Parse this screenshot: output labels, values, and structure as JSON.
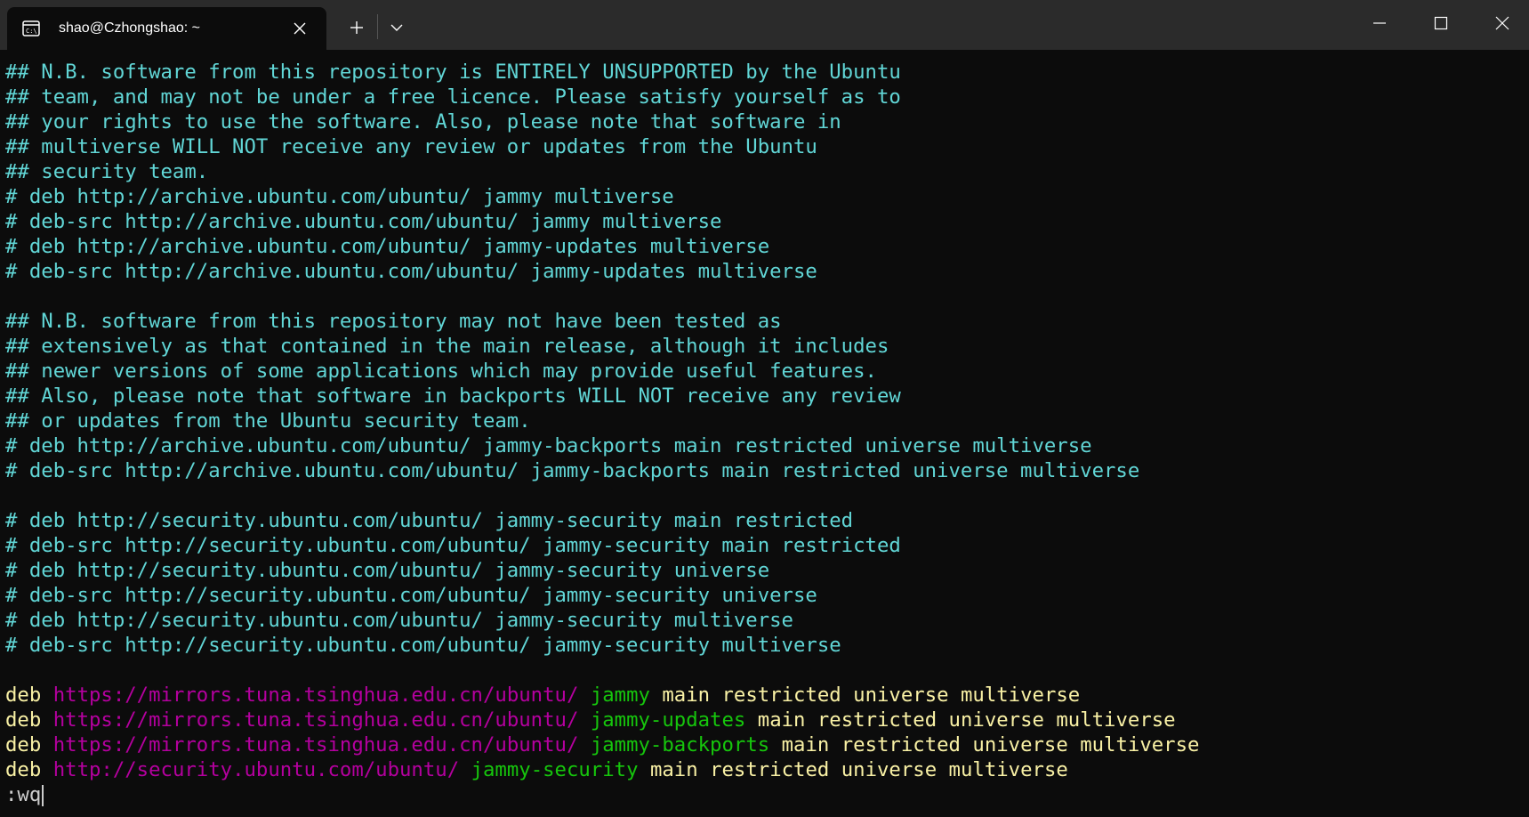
{
  "window": {
    "tab_title": "shao@Czhongshao: ~",
    "tab_icon": "terminal-icon",
    "new_tab_icon": "plus-icon",
    "dropdown_icon": "chevron-down-icon",
    "minimize_icon": "minimize-icon",
    "maximize_icon": "maximize-icon",
    "close_icon": "close-icon"
  },
  "colors": {
    "background": "#0c0c0c",
    "titlebar": "#2b2b2b",
    "comment": "#61d6d6",
    "keyword": "#f9f1a5",
    "url": "#b4009e",
    "distribution": "#16c60c"
  },
  "comment_block_1": [
    "## N.B. software from this repository is ENTIRELY UNSUPPORTED by the Ubuntu",
    "## team, and may not be under a free licence. Please satisfy yourself as to",
    "## your rights to use the software. Also, please note that software in",
    "## multiverse WILL NOT receive any review or updates from the Ubuntu",
    "## security team.",
    "# deb http://archive.ubuntu.com/ubuntu/ jammy multiverse",
    "# deb-src http://archive.ubuntu.com/ubuntu/ jammy multiverse",
    "# deb http://archive.ubuntu.com/ubuntu/ jammy-updates multiverse",
    "# deb-src http://archive.ubuntu.com/ubuntu/ jammy-updates multiverse"
  ],
  "comment_block_2": [
    "## N.B. software from this repository may not have been tested as",
    "## extensively as that contained in the main release, although it includes",
    "## newer versions of some applications which may provide useful features.",
    "## Also, please note that software in backports WILL NOT receive any review",
    "## or updates from the Ubuntu security team.",
    "# deb http://archive.ubuntu.com/ubuntu/ jammy-backports main restricted universe multiverse",
    "# deb-src http://archive.ubuntu.com/ubuntu/ jammy-backports main restricted universe multiverse"
  ],
  "comment_block_3": [
    "# deb http://security.ubuntu.com/ubuntu/ jammy-security main restricted",
    "# deb-src http://security.ubuntu.com/ubuntu/ jammy-security main restricted",
    "# deb http://security.ubuntu.com/ubuntu/ jammy-security universe",
    "# deb-src http://security.ubuntu.com/ubuntu/ jammy-security universe",
    "# deb http://security.ubuntu.com/ubuntu/ jammy-security multiverse",
    "# deb-src http://security.ubuntu.com/ubuntu/ jammy-security multiverse"
  ],
  "sources": [
    {
      "type": "deb",
      "url": "https://mirrors.tuna.tsinghua.edu.cn/ubuntu/",
      "dist": "jammy",
      "components": "main restricted universe multiverse"
    },
    {
      "type": "deb",
      "url": "https://mirrors.tuna.tsinghua.edu.cn/ubuntu/",
      "dist": "jammy-updates",
      "components": "main restricted universe multiverse"
    },
    {
      "type": "deb",
      "url": "https://mirrors.tuna.tsinghua.edu.cn/ubuntu/",
      "dist": "jammy-backports",
      "components": "main restricted universe multiverse"
    },
    {
      "type": "deb",
      "url": "http://security.ubuntu.com/ubuntu/",
      "dist": "jammy-security",
      "components": "main restricted universe multiverse"
    }
  ],
  "command_line": ":wq"
}
